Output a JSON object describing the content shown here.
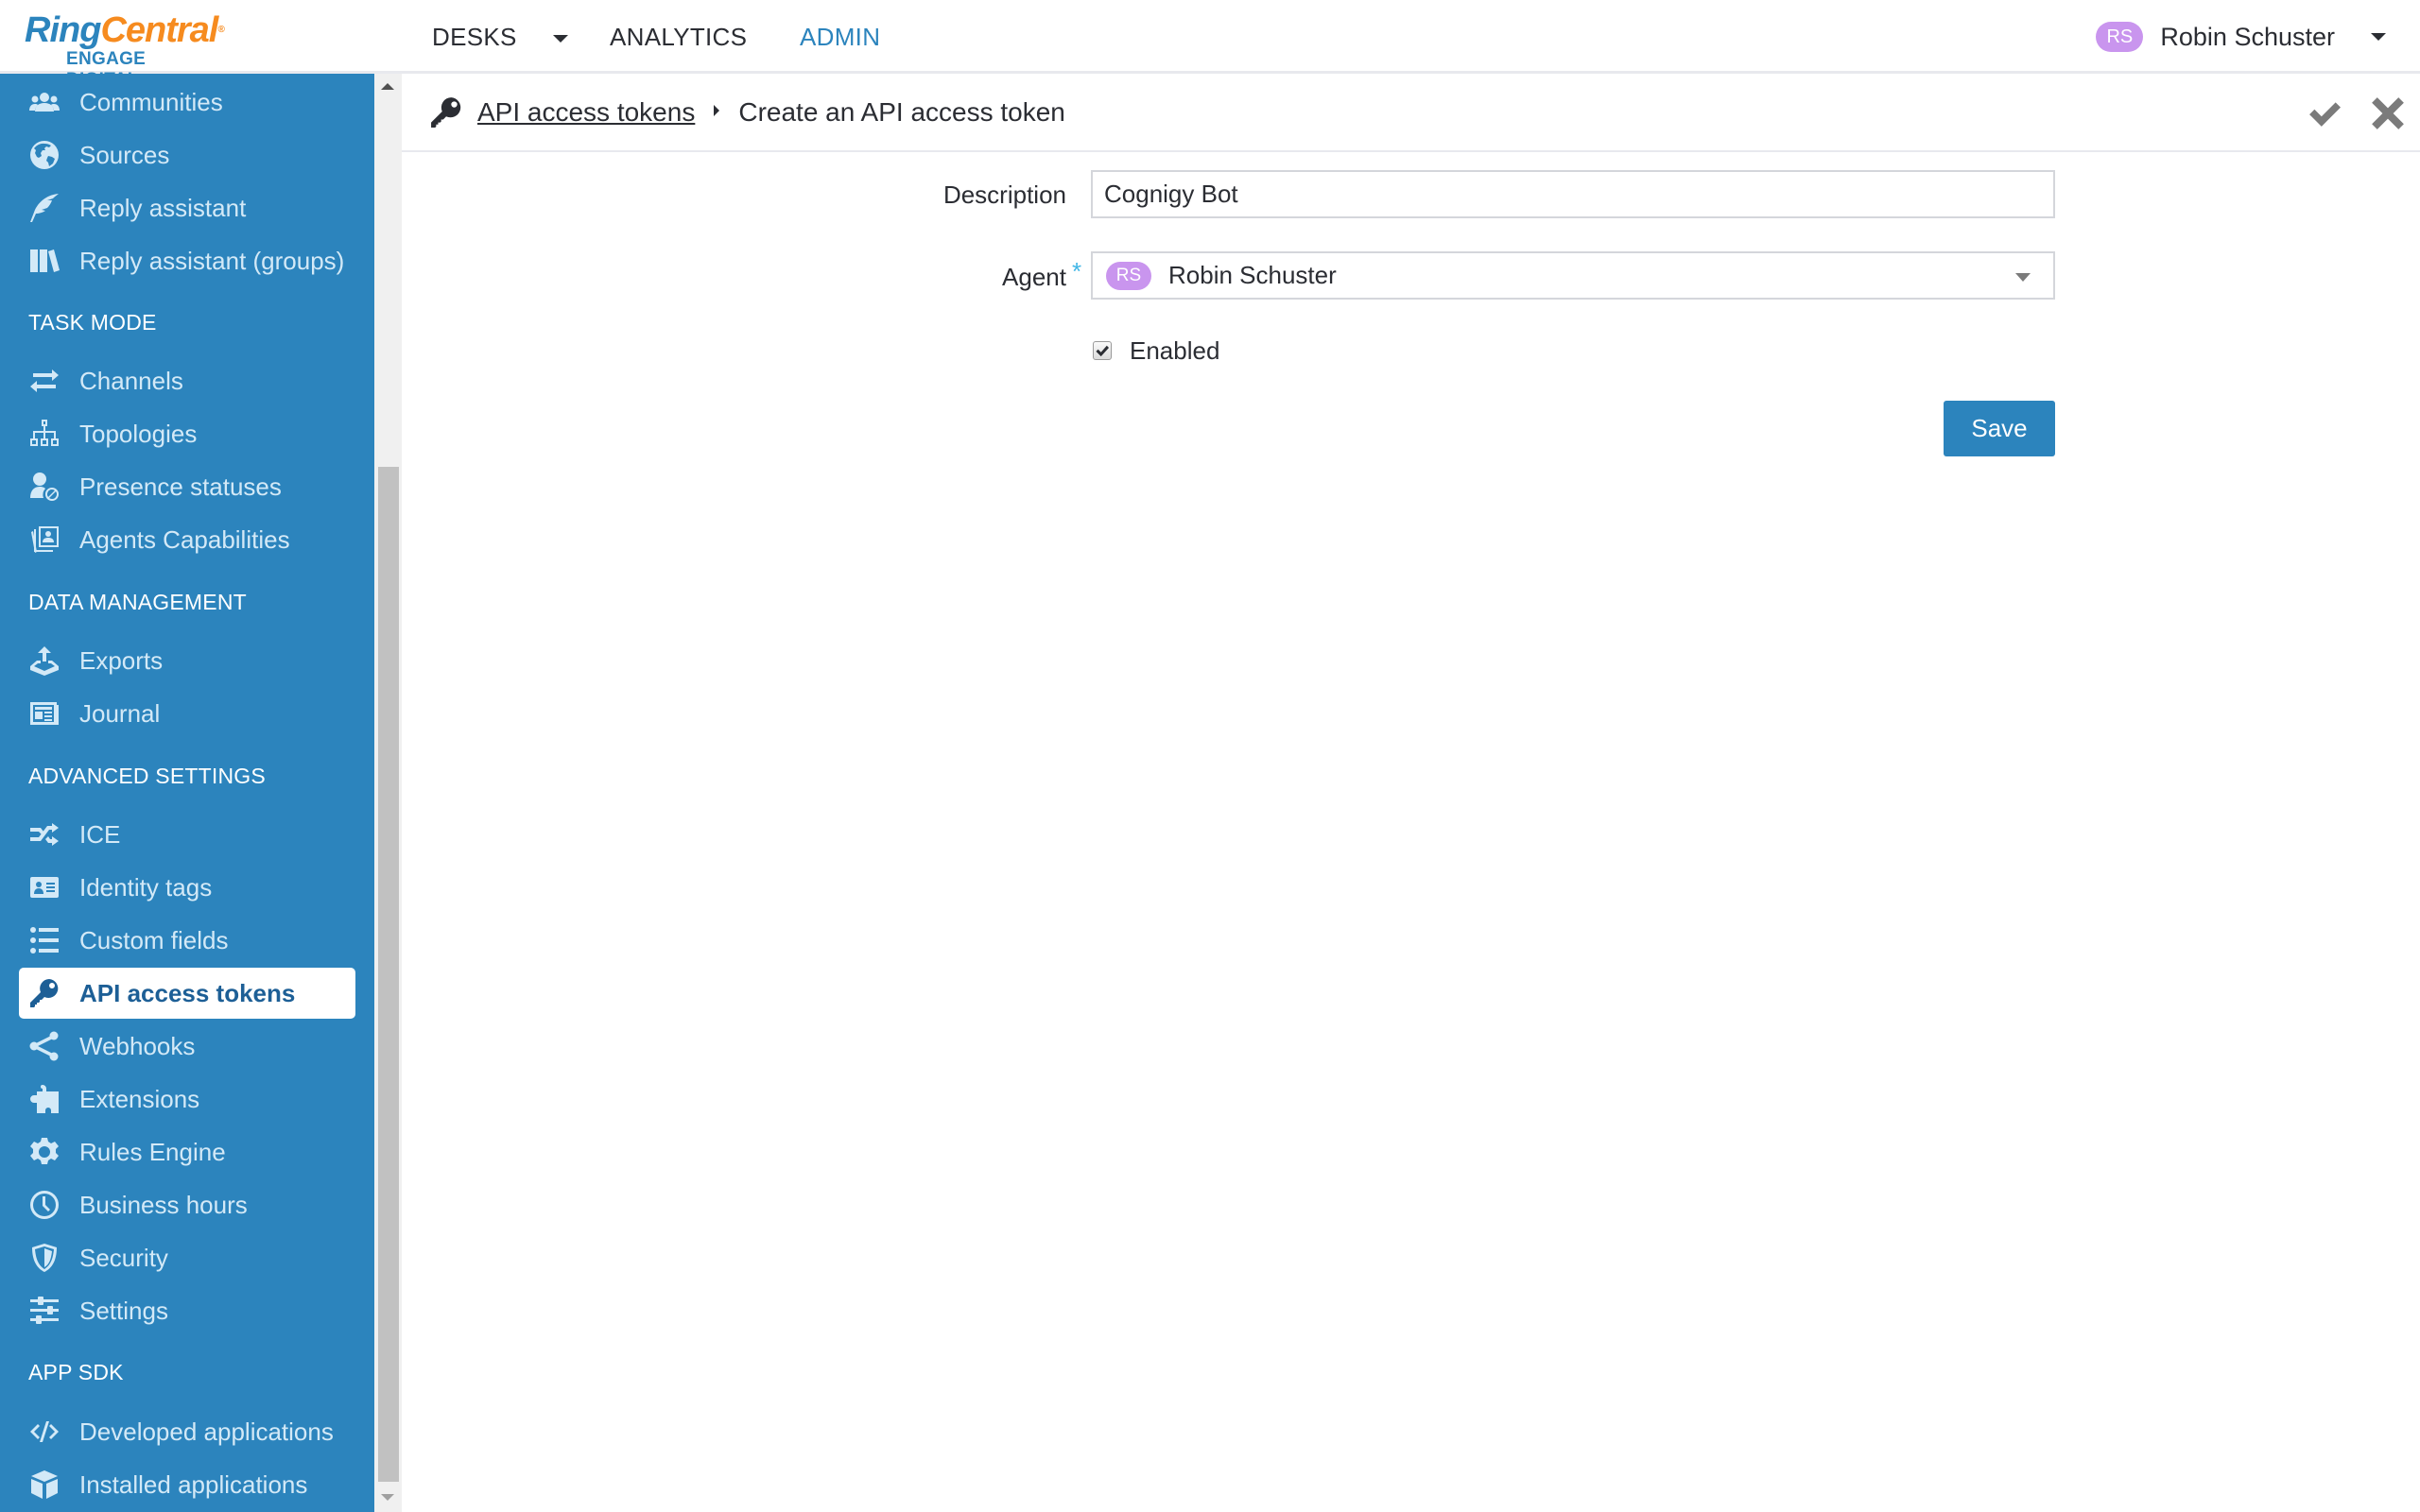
{
  "app": {
    "logo_primary_a": "Ring",
    "logo_primary_b": "Central",
    "logo_registered": "®",
    "logo_secondary": "ENGAGE DIGITAL"
  },
  "topnav": {
    "items": [
      {
        "label": "DESKS",
        "has_dropdown": true,
        "active": false
      },
      {
        "label": "ANALYTICS",
        "has_dropdown": false,
        "active": false
      },
      {
        "label": "ADMIN",
        "has_dropdown": false,
        "active": true
      }
    ]
  },
  "user": {
    "initials": "RS",
    "name": "Robin Schuster",
    "avatar_color": "#c995ee"
  },
  "sidebar": {
    "groups": [
      {
        "header": null,
        "items": [
          {
            "label": "Communities",
            "icon": "users-icon"
          },
          {
            "label": "Sources",
            "icon": "globe-icon"
          },
          {
            "label": "Reply assistant",
            "icon": "feather-icon"
          },
          {
            "label": "Reply assistant (groups)",
            "icon": "books-icon"
          }
        ]
      },
      {
        "header": "TASK MODE",
        "items": [
          {
            "label": "Channels",
            "icon": "exchange-icon"
          },
          {
            "label": "Topologies",
            "icon": "sitemap-icon"
          },
          {
            "label": "Presence statuses",
            "icon": "user-blocked-icon"
          },
          {
            "label": "Agents Capabilities",
            "icon": "id-cards-icon"
          }
        ]
      },
      {
        "header": "DATA MANAGEMENT",
        "items": [
          {
            "label": "Exports",
            "icon": "export-tray-icon"
          },
          {
            "label": "Journal",
            "icon": "newspaper-icon"
          }
        ]
      },
      {
        "header": "ADVANCED SETTINGS",
        "items": [
          {
            "label": "ICE",
            "icon": "shuffle-icon"
          },
          {
            "label": "Identity tags",
            "icon": "id-card-icon"
          },
          {
            "label": "Custom fields",
            "icon": "list-icon"
          },
          {
            "label": "API access tokens",
            "icon": "key-icon",
            "active": true
          },
          {
            "label": "Webhooks",
            "icon": "share-icon"
          },
          {
            "label": "Extensions",
            "icon": "puzzle-icon"
          },
          {
            "label": "Rules Engine",
            "icon": "gear-icon"
          },
          {
            "label": "Business hours",
            "icon": "clock-icon"
          },
          {
            "label": "Security",
            "icon": "shield-icon"
          },
          {
            "label": "Settings",
            "icon": "sliders-icon"
          }
        ]
      },
      {
        "header": "APP SDK",
        "items": [
          {
            "label": "Developed applications",
            "icon": "code-icon"
          },
          {
            "label": "Installed applications",
            "icon": "cube-icon"
          }
        ]
      }
    ],
    "accent_color": "#2c84bd"
  },
  "breadcrumb": {
    "icon": "key-icon",
    "parent": "API access tokens",
    "current": "Create an API access token",
    "actions": [
      {
        "name": "confirm",
        "icon": "check-icon"
      },
      {
        "name": "close",
        "icon": "close-icon"
      }
    ]
  },
  "form": {
    "description": {
      "label": "Description",
      "value": "Cognigy Bot"
    },
    "agent": {
      "label": "Agent",
      "required_mark": "*",
      "initials": "RS",
      "value": "Robin Schuster"
    },
    "enabled": {
      "label": "Enabled",
      "checked": true
    },
    "save_label": "Save"
  }
}
